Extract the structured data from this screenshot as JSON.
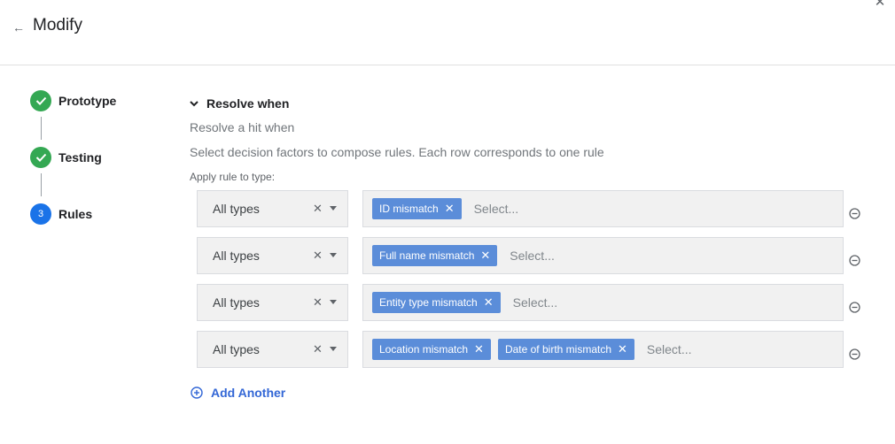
{
  "header": {
    "title": "Modify"
  },
  "steps": [
    {
      "label": "Prototype",
      "state": "done"
    },
    {
      "label": "Testing",
      "state": "done"
    },
    {
      "label": "Rules",
      "state": "active",
      "number": "3"
    }
  ],
  "section": {
    "title": "Resolve when",
    "subtitle": "Resolve a hit when",
    "description": "Select decision factors to compose rules. Each row corresponds to one rule",
    "apply_label": "Apply rule to type:"
  },
  "rules": [
    {
      "type": "All types",
      "chips": [
        "ID mismatch"
      ],
      "placeholder": "Select..."
    },
    {
      "type": "All types",
      "chips": [
        "Full name mismatch"
      ],
      "placeholder": "Select..."
    },
    {
      "type": "All types",
      "chips": [
        "Entity type mismatch"
      ],
      "placeholder": "Select..."
    },
    {
      "type": "All types",
      "chips": [
        "Location mismatch",
        "Date of birth mismatch"
      ],
      "placeholder": "Select..."
    }
  ],
  "add_another_label": "Add Another",
  "colors": {
    "done": "#34a853",
    "active": "#1a73e8",
    "chip": "#5b8dd9",
    "link": "#3367d6"
  }
}
